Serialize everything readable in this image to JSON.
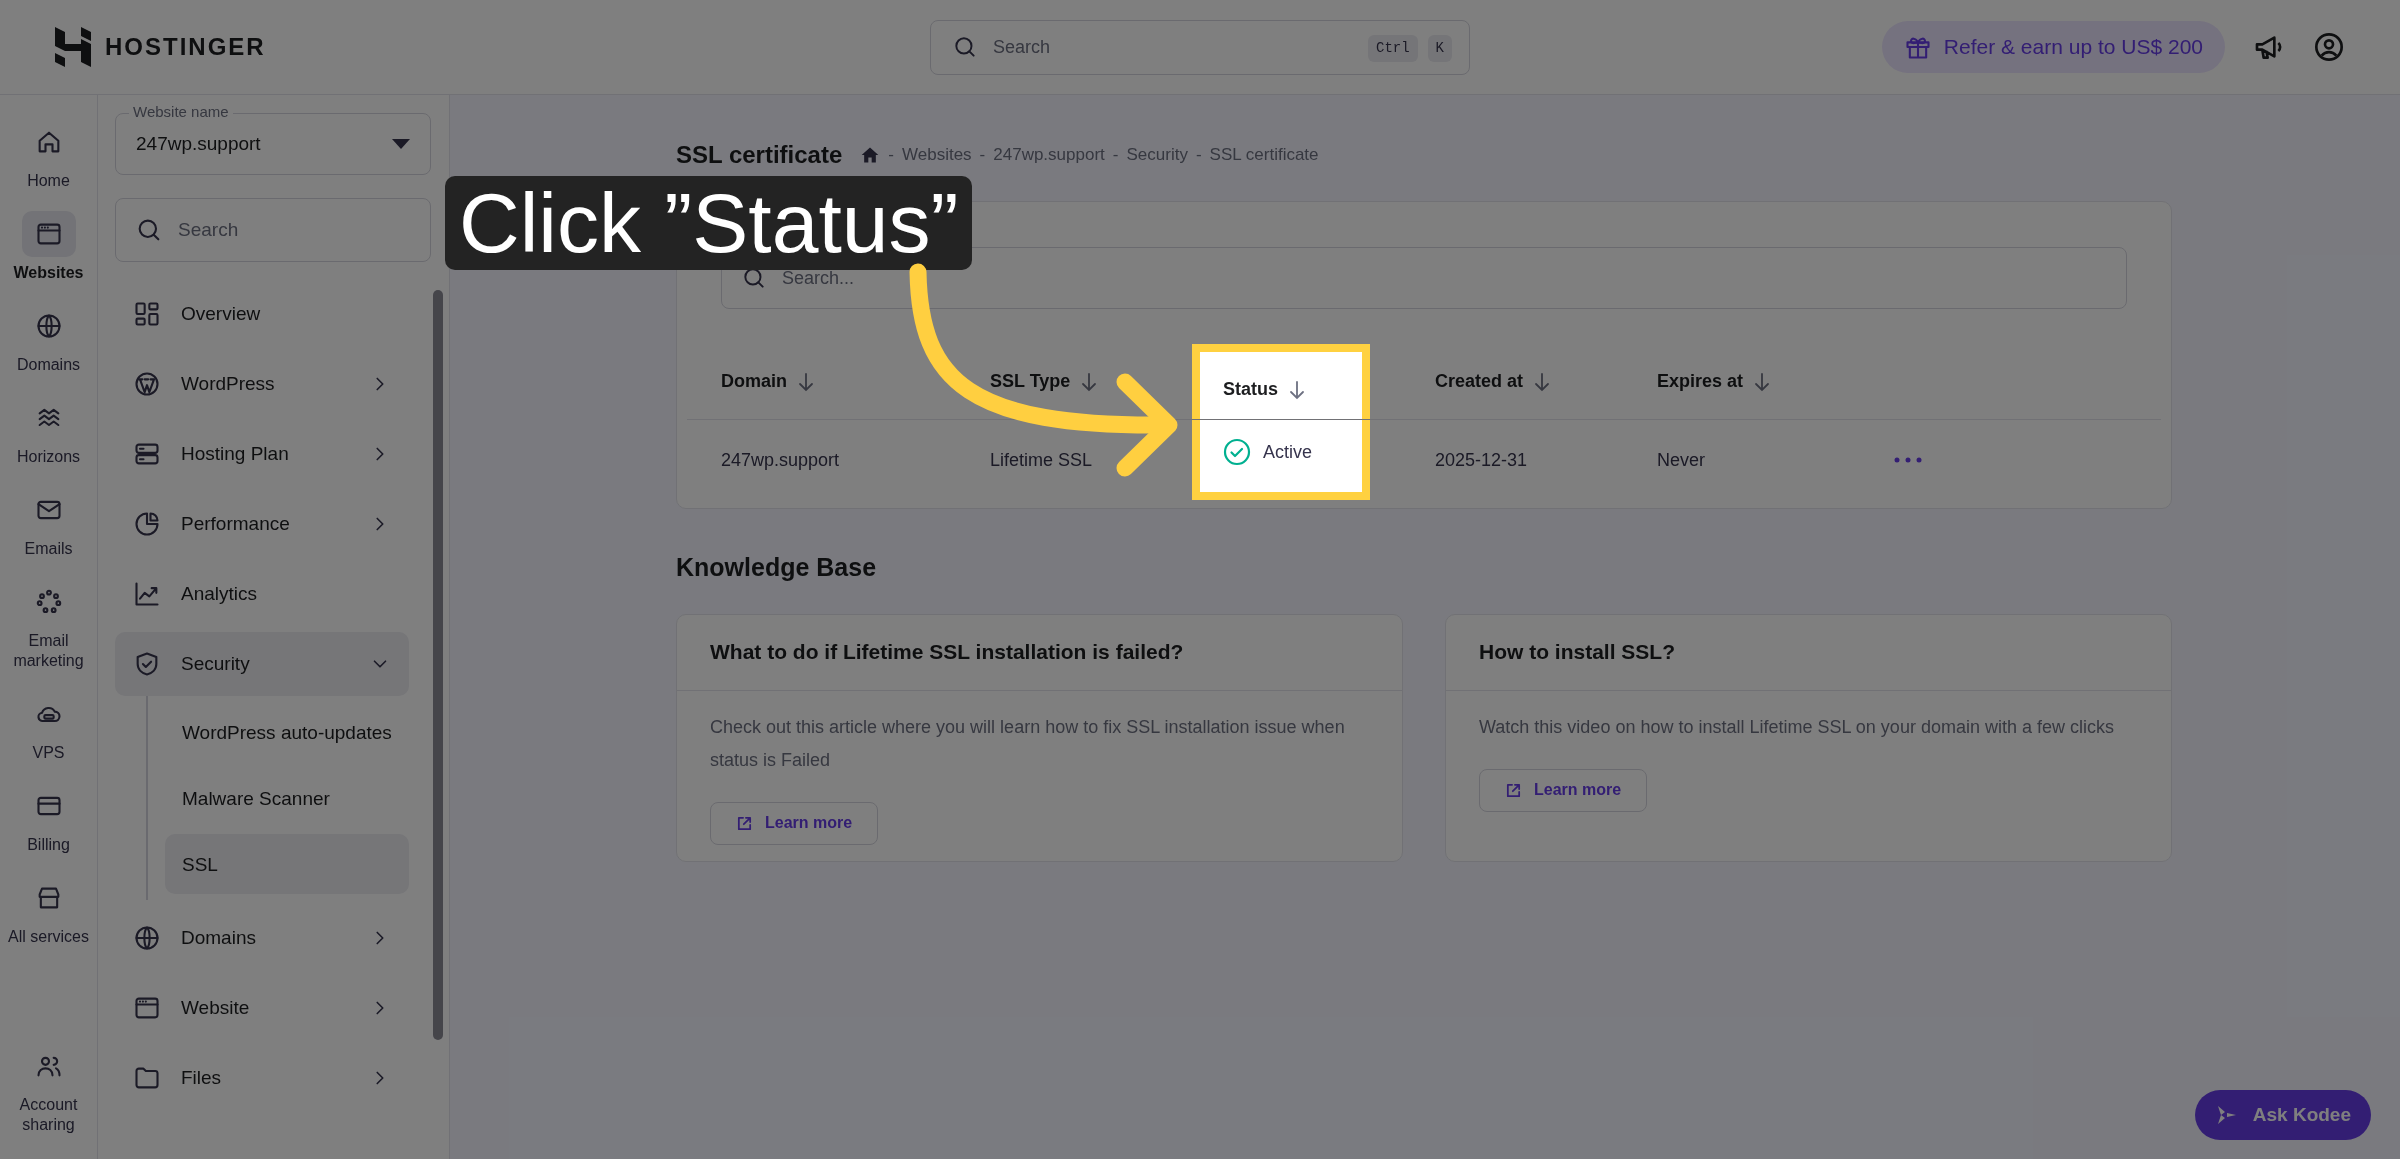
{
  "header": {
    "logo": "HOSTINGER",
    "search": {
      "placeholder": "Search",
      "shortcut": [
        "Ctrl",
        "K"
      ]
    },
    "refer_button": "Refer & earn up to US$ 200"
  },
  "nav_rail": [
    {
      "label": "Home",
      "selected": false
    },
    {
      "label": "Websites",
      "selected": true
    },
    {
      "label": "Domains",
      "selected": false
    },
    {
      "label": "Horizons",
      "selected": false
    },
    {
      "label": "Emails",
      "selected": false
    },
    {
      "label": "Email marketing",
      "selected": false
    },
    {
      "label": "VPS",
      "selected": false
    },
    {
      "label": "Billing",
      "selected": false
    },
    {
      "label": "All services",
      "selected": false
    }
  ],
  "nav_rail_bottom": {
    "label": "Account sharing",
    "selected": false
  },
  "sidebar": {
    "website_select": {
      "label": "Website name",
      "value": "247wp.support"
    },
    "search": {
      "placeholder": "Search"
    },
    "items": [
      {
        "label": "Overview",
        "kind": "link"
      },
      {
        "label": "WordPress",
        "kind": "group",
        "expanded": false
      },
      {
        "label": "Hosting Plan",
        "kind": "group",
        "expanded": false
      },
      {
        "label": "Performance",
        "kind": "group",
        "expanded": false
      },
      {
        "label": "Analytics",
        "kind": "link"
      },
      {
        "label": "Security",
        "kind": "group",
        "expanded": true,
        "children": [
          {
            "label": "WordPress auto-updates",
            "selected": false
          },
          {
            "label": "Malware Scanner",
            "selected": false
          },
          {
            "label": "SSL",
            "selected": true
          }
        ]
      },
      {
        "label": "Domains",
        "kind": "group",
        "expanded": false
      },
      {
        "label": "Website",
        "kind": "group",
        "expanded": false
      },
      {
        "label": "Files",
        "kind": "group",
        "expanded": false
      }
    ]
  },
  "page": {
    "title": "SSL certificate",
    "breadcrumb": {
      "separator": "-",
      "items": [
        "Websites",
        "247wp.support",
        "Security",
        "SSL certificate"
      ]
    },
    "ssl_table": {
      "search_placeholder": "Search...",
      "columns": [
        {
          "label": "Domain",
          "highlighted": false
        },
        {
          "label": "SSL Type",
          "highlighted": false
        },
        {
          "label": "Status",
          "highlighted": true
        },
        {
          "label": "Created at",
          "highlighted": false
        },
        {
          "label": "Expires at",
          "highlighted": false
        }
      ],
      "rows": [
        {
          "domain": "247wp.support",
          "ssl_type": "Lifetime SSL",
          "status": "Active",
          "created_at": "2025-12-31",
          "expires_at": "Never"
        }
      ]
    },
    "knowledge_base": {
      "title": "Knowledge Base",
      "articles": [
        {
          "title": "What to do if Lifetime SSL installation is failed?",
          "description": "Check out this article where you will learn how to fix SSL installation issue when status is Failed",
          "link": "Learn more"
        },
        {
          "title": "How to install SSL?",
          "description": "Watch this video on how to install Lifetime SSL on your domain with a few clicks",
          "link": "Learn more"
        }
      ]
    }
  },
  "ask_button": "Ask Kodee",
  "tutorial": {
    "callout": "Click ”Status”"
  }
}
